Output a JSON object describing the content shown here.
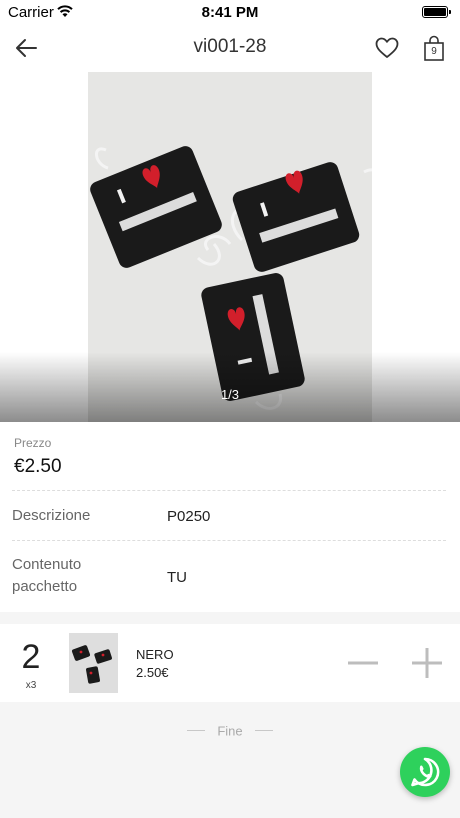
{
  "status_bar": {
    "carrier": "Carrier",
    "time": "8:41 PM"
  },
  "nav": {
    "title": "vi001-28",
    "cart_count": "9"
  },
  "gallery": {
    "indicator": "1/3"
  },
  "price": {
    "label": "Prezzo",
    "value": "€2.50"
  },
  "details": [
    {
      "label": "Descrizione",
      "value": "P0250"
    },
    {
      "label": "Contenuto pacchetto",
      "value": "TU"
    }
  ],
  "variant": {
    "quantity": "2",
    "multiplier": "x3",
    "name": "NERO",
    "price": "2.50€"
  },
  "footer": {
    "end_text": "Fine"
  },
  "colors": {
    "whatsapp": "#2ed15c",
    "mask": "#1a1a1a",
    "heart": "#d21f2b"
  }
}
